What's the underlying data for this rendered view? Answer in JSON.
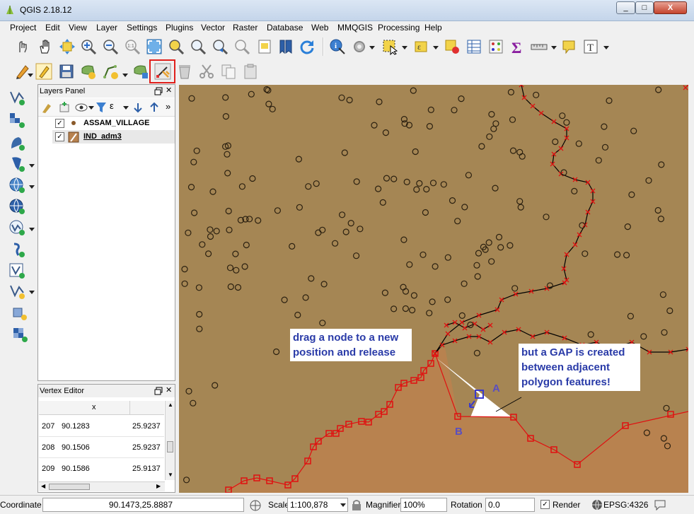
{
  "window": {
    "title": "QGIS 2.18.12",
    "controls": [
      "_",
      "□",
      "X"
    ]
  },
  "menu": [
    "Project",
    "Edit",
    "View",
    "Layer",
    "Settings",
    "Plugins",
    "Vector",
    "Raster",
    "Database",
    "Web",
    "MMQGIS",
    "Processing",
    "Help"
  ],
  "layers_panel": {
    "title": "Layers Panel",
    "more": "»",
    "layers": [
      {
        "name": "ASSAM_VILLAGE",
        "checked": "✓"
      },
      {
        "name": "IND_adm3",
        "checked": "✓"
      }
    ]
  },
  "vertex_editor": {
    "title": "Vertex Editor",
    "column_x": "x",
    "rows": [
      {
        "index": "207",
        "x": "90.1283",
        "y": "25.9237"
      },
      {
        "index": "208",
        "x": "90.1506",
        "y": "25.9237"
      },
      {
        "index": "209",
        "x": "90.1586",
        "y": "25.9137"
      }
    ]
  },
  "map": {
    "callout_drag_line1": "drag a node to a new",
    "callout_drag_line2": "position and release",
    "callout_gap_line1": "but a GAP is created",
    "callout_gap_line2": "between adjacent",
    "callout_gap_line3": "polygon features!",
    "label_a": "A",
    "label_b": "B",
    "colors": {
      "background": "#a58654",
      "polygon_fill": "#b8824f",
      "vertex": "#e01010",
      "gap": "#ffffff",
      "callout_text": "#2a3ba8"
    }
  },
  "statusbar": {
    "coordinate_label": "Coordinate",
    "coordinate_value": "90.1473,25.8887",
    "scale_label": "Scale",
    "scale_value": "1:100,878",
    "magnifier_label": "Magnifier",
    "magnifier_value": "100%",
    "rotation_label": "Rotation",
    "rotation_value": "0.0",
    "render_label": "Render",
    "render_checked": "✓",
    "crs": "EPSG:4326"
  }
}
